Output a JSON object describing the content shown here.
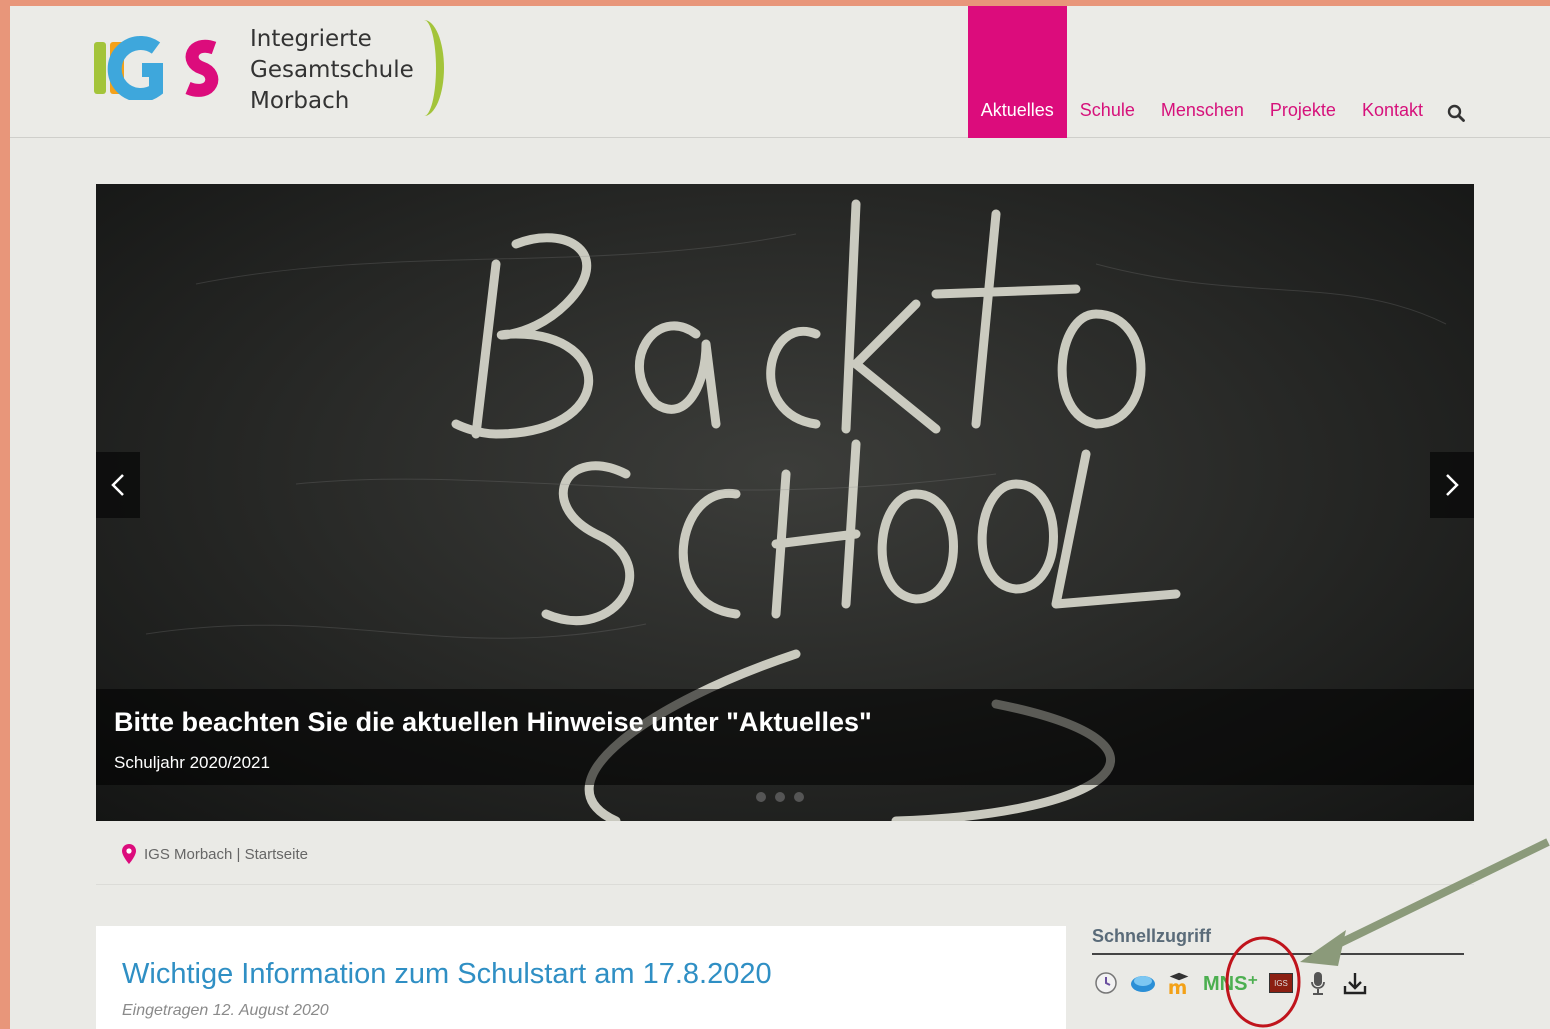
{
  "logo": {
    "lines": [
      "Integrierte",
      "Gesamtschule",
      "Morbach"
    ]
  },
  "nav": {
    "items": [
      {
        "label": "Aktuelles",
        "active": true
      },
      {
        "label": "Schule",
        "active": false
      },
      {
        "label": "Menschen",
        "active": false
      },
      {
        "label": "Projekte",
        "active": false
      },
      {
        "label": "Kontakt",
        "active": false
      }
    ],
    "search_icon": "search-icon"
  },
  "slider": {
    "caption_title": "Bitte beachten Sie die aktuellen Hinweise unter \"Aktuelles\"",
    "caption_subtitle": "Schuljahr 2020/2021",
    "prev_icon": "chevron-left-icon",
    "next_icon": "chevron-right-icon",
    "slide_count": 3
  },
  "breadcrumb": {
    "icon": "map-pin-icon",
    "text": "IGS Morbach | Startseite"
  },
  "article": {
    "title": "Wichtige Information zum Schulstart am 17.8.2020",
    "date": "Eingetragen 12. August 2020"
  },
  "quick_access": {
    "title": "Schnellzugriff",
    "icons": [
      "clock-icon",
      "cloud-icon",
      "moodle-icon",
      "mns-plus-icon",
      "igs-icon",
      "microphone-icon",
      "download-icon"
    ],
    "mns_label": "MNS⁺",
    "igs_label": "IGS"
  },
  "colors": {
    "brand_magenta": "#dc0c7c",
    "link_blue": "#2f8fc4",
    "annotation_red": "#c0141c",
    "annotation_arrow": "#8b9a7a"
  }
}
